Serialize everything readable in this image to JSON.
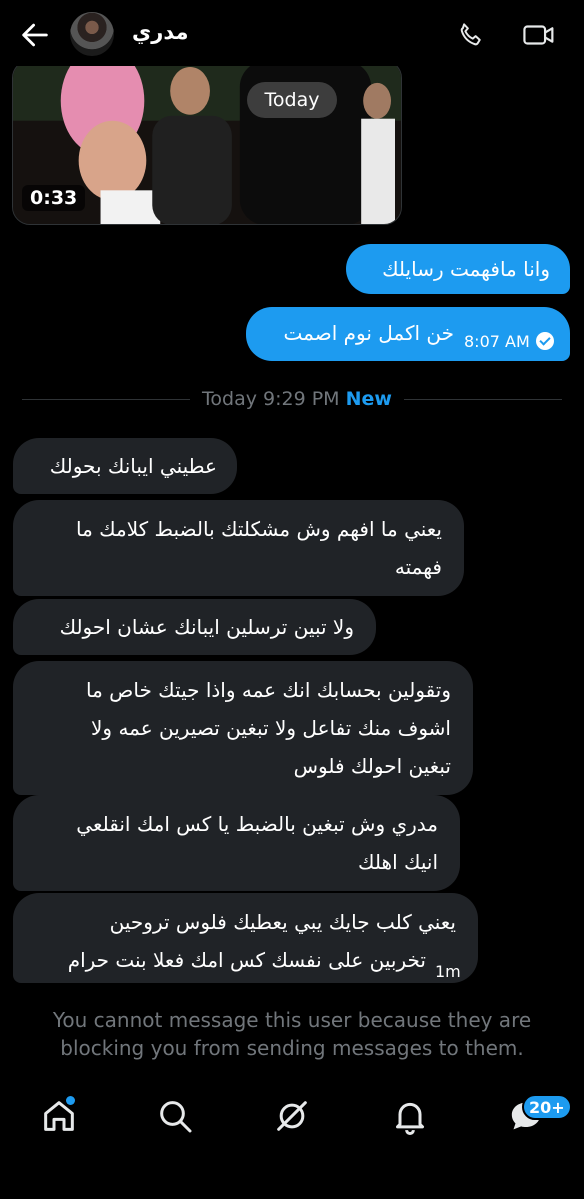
{
  "header": {
    "contact_name": "مدري",
    "back_icon": "arrow-left-icon",
    "call_icon": "phone-icon",
    "video_icon": "video-camera-icon"
  },
  "video": {
    "duration": "0:33",
    "date_pill": "Today"
  },
  "outgoing": [
    {
      "text": "وانا مافهمت رسايلك"
    },
    {
      "text": "خن اكمل نوم اصمت",
      "time": "8:07 AM",
      "status_icon": "read-check-icon"
    }
  ],
  "divider": {
    "label": "Today 9:29 PM",
    "new_label": "New"
  },
  "incoming": [
    {
      "lines": [
        "عطيني ايبانك بحولك"
      ]
    },
    {
      "lines": [
        "يعني ما افهم وش مشكلتك بالضبط كلامك ما",
        "فهمته"
      ]
    },
    {
      "lines": [
        "ولا تبين ترسلين ايبانك عشان احولك"
      ]
    },
    {
      "lines": [
        "وتقولين بحسابك انك عمه واذا جيتك خاص ما",
        "اشوف منك تفاعل ولا تبغين تصيرين عمه ولا",
        "تبغين احولك فلوس"
      ]
    },
    {
      "lines": [
        "مدري وش تبغين بالضبط يا كس امك انقلعي",
        "انيك اهلك"
      ]
    },
    {
      "lines": [
        "يعني كلب جايك يبي يعطيك فلوس تروحين",
        "تخربين على نفسك كس امك فعلا بنت حرام"
      ],
      "time": "1m"
    }
  ],
  "blocked_notice": "You cannot message this user because they are blocking you from sending messages to them.",
  "nav": {
    "items": [
      "home-icon",
      "search-icon",
      "grok-icon",
      "notifications-bell-icon",
      "messages-icon"
    ],
    "messages_badge": "20+"
  },
  "colors": {
    "accent": "#1d9bf0",
    "bubble_incoming": "#202327",
    "background": "#000000"
  }
}
